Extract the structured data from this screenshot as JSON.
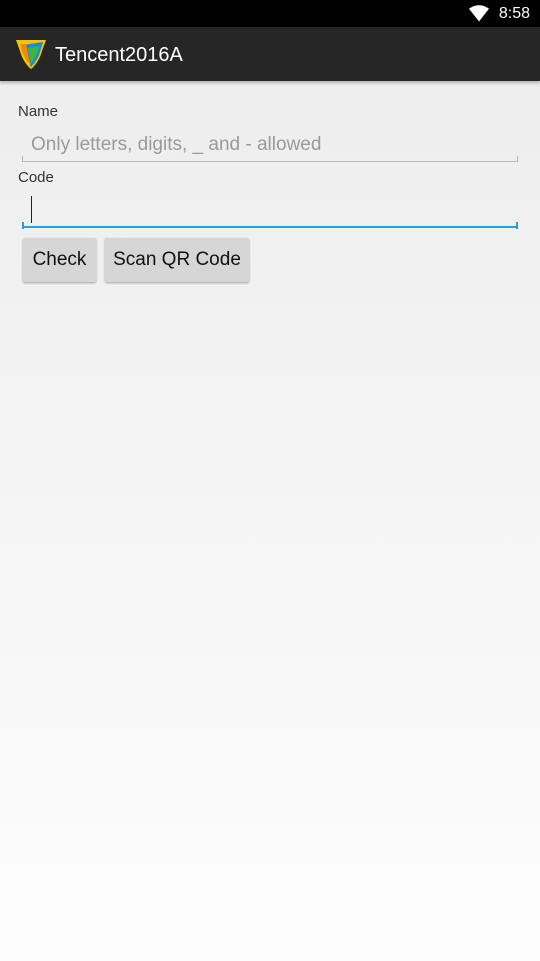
{
  "status_bar": {
    "time": "8:58",
    "wifi_icon": "wifi-icon"
  },
  "app": {
    "title": "Tencent2016A",
    "logo_icon": "tencent-logo-icon"
  },
  "form": {
    "name_label": "Name",
    "name_value": "",
    "name_placeholder": "Only letters, digits, _ and - allowed",
    "code_label": "Code",
    "code_value": "",
    "code_placeholder": ""
  },
  "buttons": {
    "check_label": "Check",
    "scan_label": "Scan QR Code"
  },
  "colors": {
    "accent": "#2a9fd6",
    "action_bar": "#262626",
    "status_bar": "#000000",
    "button_bg": "#d6d6d6"
  }
}
